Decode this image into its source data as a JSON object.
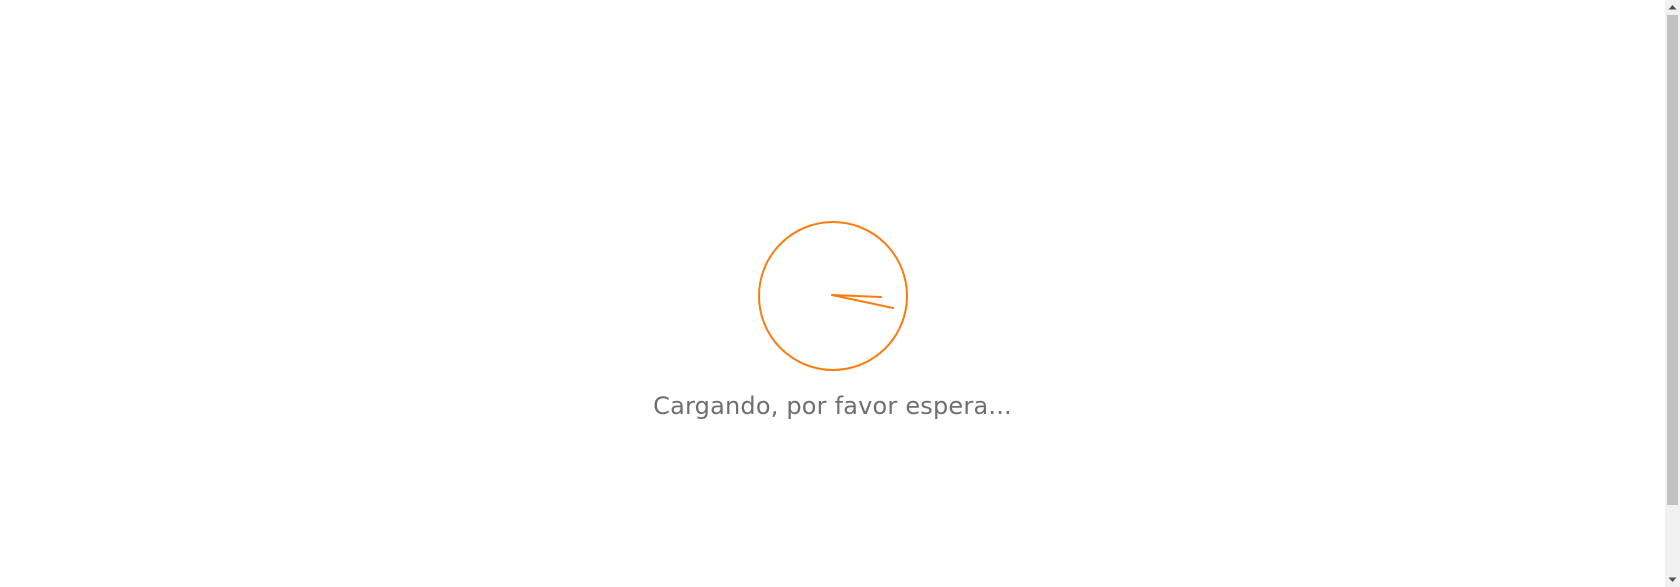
{
  "loader": {
    "icon": "clock-spinner-icon",
    "text": "Cargando, por favor espera...",
    "accent_color": "#ff7a0b",
    "text_color": "#6f6f6f"
  },
  "scrollbar": {
    "up_icon": "arrow-up-icon",
    "down_icon": "arrow-down-icon"
  }
}
